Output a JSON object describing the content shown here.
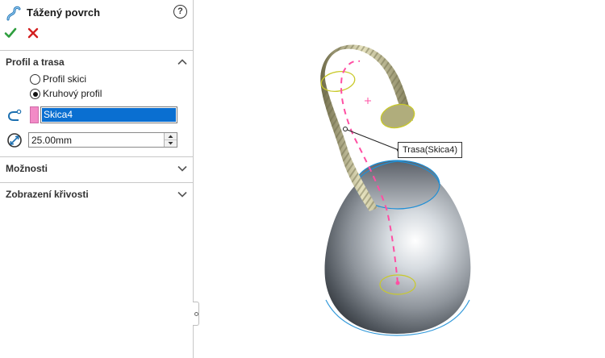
{
  "panel": {
    "title": "Tážený povrch",
    "help_icon": "help-icon",
    "ok_icon": "checkmark-icon",
    "cancel_icon": "close-icon",
    "sections": {
      "profile_path": {
        "label": "Profil a trasa",
        "expanded": true,
        "options": [
          {
            "label": "Profil skici",
            "checked": false
          },
          {
            "label": "Kruhový profil",
            "checked": true
          }
        ],
        "path_selection": "Skica4",
        "diameter": "25.00mm"
      },
      "options": {
        "label": "Možnosti",
        "expanded": false
      },
      "curvature_display": {
        "label": "Zobrazení křivosti",
        "expanded": false
      }
    }
  },
  "viewport": {
    "callout": "Trasa(Skica4)"
  },
  "colors": {
    "accent": "#0a6fd1",
    "ok": "#2e9e3e",
    "cancel": "#d32020",
    "path_swatch": "#f28ac6",
    "sketch_line": "#ff4fa3",
    "edge_highlight": "#1e8fd6"
  }
}
